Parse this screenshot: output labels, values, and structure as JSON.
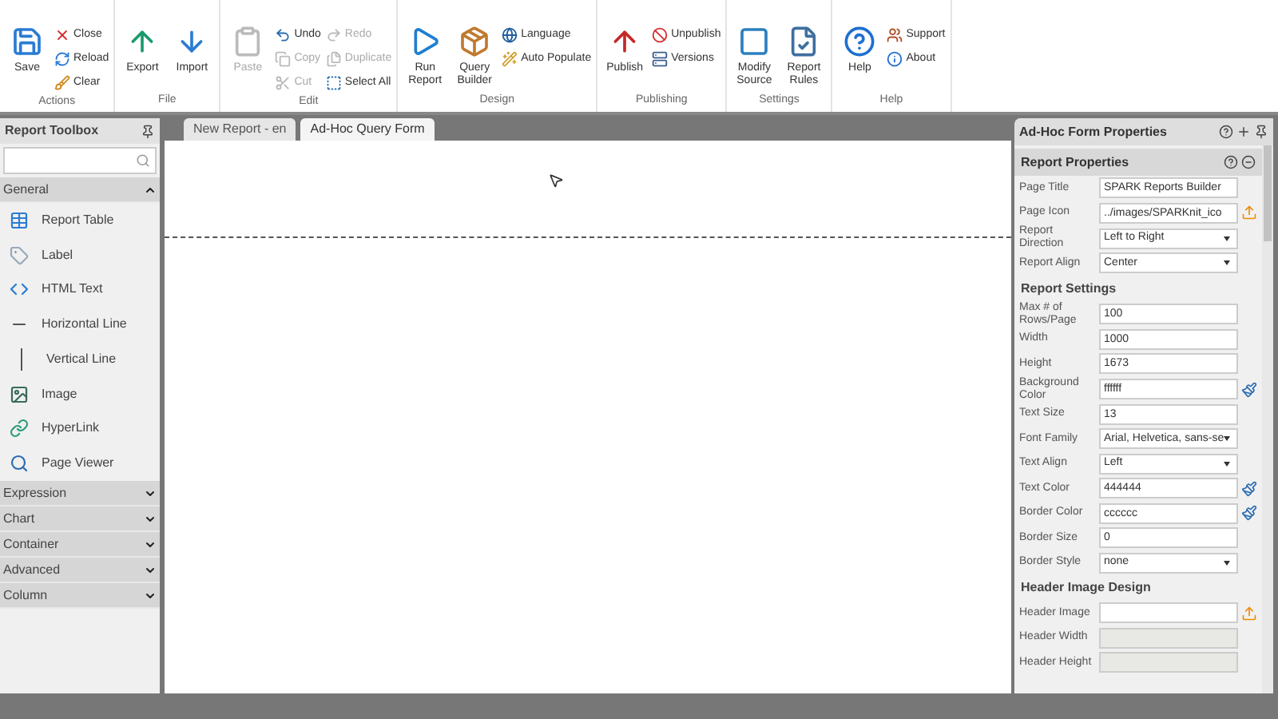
{
  "ribbon": [
    {
      "label": "Actions",
      "columns": [
        [
          {
            "kind": "large",
            "label": "Save",
            "disabled": false
          }
        ],
        [
          {
            "kind": "small",
            "label": "Close",
            "disabled": false
          },
          {
            "kind": "small",
            "label": "Reload",
            "disabled": false
          },
          {
            "kind": "small",
            "label": "Clear",
            "disabled": false
          }
        ]
      ]
    },
    {
      "label": "File",
      "columns": [
        [
          {
            "kind": "large",
            "label": "Export",
            "disabled": false
          }
        ],
        [
          {
            "kind": "large",
            "label": "Import",
            "disabled": false
          }
        ]
      ]
    },
    {
      "label": "Edit",
      "columns": [
        [
          {
            "kind": "large",
            "label": "Paste",
            "disabled": true
          }
        ],
        [
          {
            "kind": "small",
            "label": "Undo",
            "disabled": false
          },
          {
            "kind": "small",
            "label": "Copy",
            "disabled": true
          },
          {
            "kind": "small",
            "label": "Cut",
            "disabled": true
          }
        ],
        [
          {
            "kind": "small",
            "label": "Redo",
            "disabled": true
          },
          {
            "kind": "small",
            "label": "Duplicate",
            "disabled": true
          },
          {
            "kind": "small",
            "label": "Select All",
            "disabled": false
          }
        ]
      ]
    },
    {
      "label": "Design",
      "columns": [
        [
          {
            "kind": "large",
            "label": "Run Report",
            "disabled": false
          }
        ],
        [
          {
            "kind": "large",
            "label": "Query Builder",
            "disabled": false
          }
        ],
        [
          {
            "kind": "small",
            "label": "Language",
            "disabled": false
          },
          {
            "kind": "small",
            "label": "Auto Populate",
            "disabled": false
          }
        ]
      ]
    },
    {
      "label": "Publishing",
      "columns": [
        [
          {
            "kind": "large",
            "label": "Publish",
            "disabled": false
          }
        ],
        [
          {
            "kind": "small",
            "label": "Unpublish",
            "disabled": false
          },
          {
            "kind": "small",
            "label": "Versions",
            "disabled": false
          }
        ]
      ]
    },
    {
      "label": "Settings",
      "columns": [
        [
          {
            "kind": "large",
            "label": "Modify Source",
            "disabled": false
          }
        ],
        [
          {
            "kind": "large",
            "label": "Report Rules",
            "disabled": false
          }
        ]
      ]
    },
    {
      "label": "Help",
      "columns": [
        [
          {
            "kind": "large",
            "label": "Help",
            "disabled": false
          }
        ],
        [
          {
            "kind": "small",
            "label": "Support",
            "disabled": false
          },
          {
            "kind": "small",
            "label": "About",
            "disabled": false
          }
        ]
      ]
    }
  ],
  "toolbox": {
    "title": "Report Toolbox",
    "categories": [
      {
        "label": "General",
        "expanded": true,
        "items": [
          {
            "label": "Report Table"
          },
          {
            "label": "Label"
          },
          {
            "label": "HTML Text"
          },
          {
            "label": "Horizontal Line"
          },
          {
            "label": "Vertical Line"
          },
          {
            "label": "Image"
          },
          {
            "label": "HyperLink"
          },
          {
            "label": "Page Viewer"
          }
        ]
      },
      {
        "label": "Expression",
        "expanded": false
      },
      {
        "label": "Chart",
        "expanded": false
      },
      {
        "label": "Container",
        "expanded": false
      },
      {
        "label": "Advanced",
        "expanded": false
      },
      {
        "label": "Column",
        "expanded": false
      }
    ]
  },
  "tabs": [
    {
      "label": "New Report - en",
      "selected": false
    },
    {
      "label": "Ad-Hoc Query Form",
      "selected": true
    }
  ],
  "properties": {
    "title": "Ad-Hoc Form Properties",
    "section": "Report Properties",
    "rows": [
      {
        "kind": "text",
        "label": "Page Title",
        "value": "SPARK Reports Builder"
      },
      {
        "kind": "upload",
        "label": "Page Icon",
        "value": "../images/SPARKnit_ico"
      },
      {
        "kind": "select",
        "label": "Report Direction",
        "value": "Left to Right"
      },
      {
        "kind": "select",
        "label": "Report Align",
        "value": "Center"
      },
      {
        "kind": "heading",
        "label": "Report Settings"
      },
      {
        "kind": "text",
        "label": "Max # of Rows/Page",
        "value": "100"
      },
      {
        "kind": "text",
        "label": "Width",
        "value": "1000"
      },
      {
        "kind": "text",
        "label": "Height",
        "value": "1673"
      },
      {
        "kind": "color",
        "label": "Background Color",
        "value": "ffffff"
      },
      {
        "kind": "text",
        "label": "Text Size",
        "value": "13"
      },
      {
        "kind": "select",
        "label": "Font Family",
        "value": "Arial, Helvetica, sans-se"
      },
      {
        "kind": "select",
        "label": "Text Align",
        "value": "Left"
      },
      {
        "kind": "color",
        "label": "Text Color",
        "value": "444444"
      },
      {
        "kind": "color",
        "label": "Border Color",
        "value": "cccccc"
      },
      {
        "kind": "text",
        "label": "Border Size",
        "value": "0"
      },
      {
        "kind": "select",
        "label": "Border Style",
        "value": "none"
      },
      {
        "kind": "heading",
        "label": "Header Image Design"
      },
      {
        "kind": "upload",
        "label": "Header Image",
        "value": ""
      },
      {
        "kind": "disabled",
        "label": "Header Width"
      },
      {
        "kind": "disabled",
        "label": "Header Height"
      }
    ]
  }
}
